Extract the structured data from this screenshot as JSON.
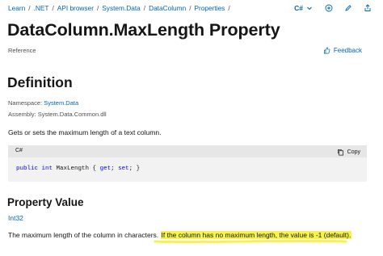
{
  "breadcrumb": {
    "items": [
      "Learn",
      ".NET",
      "API browser",
      "System.Data",
      "DataColumn",
      "Properties"
    ],
    "separator": "/"
  },
  "toolbar": {
    "language": "C#",
    "icons": [
      "chevron-down-icon",
      "add-icon",
      "edit-icon",
      "share-icon"
    ]
  },
  "page": {
    "title": "DataColumn.MaxLength Property",
    "reference_label": "Reference",
    "feedback_label": "Feedback"
  },
  "definition": {
    "heading": "Definition",
    "namespace_label": "Namespace:",
    "namespace_value": "System.Data",
    "assembly_label": "Assembly:",
    "assembly_value": "System.Data.Common.dll",
    "description": "Gets or sets the maximum length of a text column."
  },
  "code": {
    "language": "C#",
    "copy_label": "Copy",
    "tokens": [
      "public",
      " ",
      "int",
      " MaxLength { ",
      "get",
      "; ",
      "set",
      "; }"
    ]
  },
  "property_value": {
    "heading": "Property Value",
    "type_link": "Int32",
    "text_plain": "The maximum length of the column in characters. ",
    "text_highlighted": "If the column has no maximum length, the value is -1 (default)."
  },
  "colors": {
    "link": "#0065b3",
    "highlight": "#f8f34a",
    "code_keyword": "#0101fd"
  }
}
